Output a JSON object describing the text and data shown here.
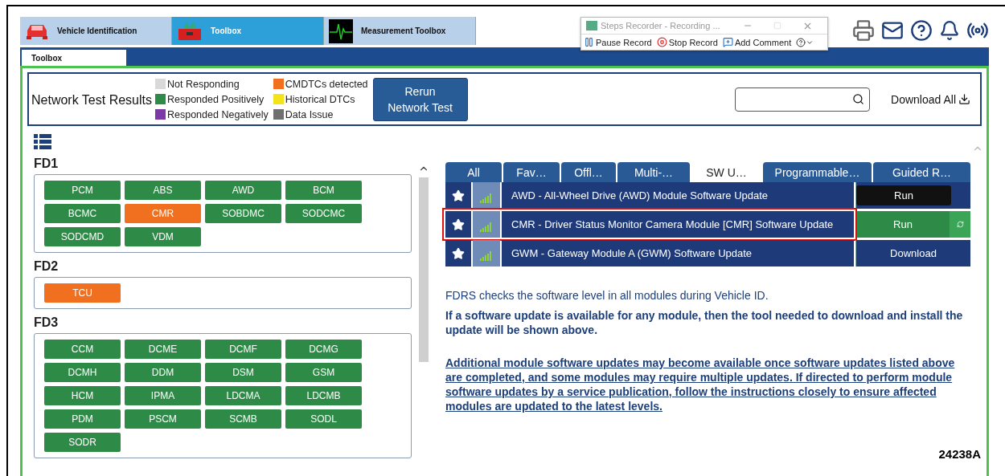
{
  "top_tabs": [
    {
      "label": "Vehicle Identification",
      "kind": "car",
      "selected": false
    },
    {
      "label": "Toolbox",
      "kind": "toolbox",
      "selected": true
    },
    {
      "label": "Measurement Toolbox",
      "kind": "scope",
      "selected": false
    }
  ],
  "recorder": {
    "title": "Steps Recorder - Recording ...",
    "buttons": [
      {
        "label": "Pause Record",
        "kind": "pause"
      },
      {
        "label": "Stop Record",
        "kind": "stop"
      },
      {
        "label": "Add Comment",
        "kind": "comment"
      }
    ]
  },
  "subtabs": [
    {
      "label": "Toolbox",
      "selected": true
    }
  ],
  "network_test": {
    "title": "Network Test Results",
    "legend": [
      {
        "label": "Not Responding",
        "color": "#d9d9d9"
      },
      {
        "label": "Responded Positively",
        "color": "#2e8b47"
      },
      {
        "label": "Responded Negatively",
        "color": "#7b3aa6"
      },
      {
        "label": "CMDTCs detected",
        "color": "#f07020"
      },
      {
        "label": "Historical DTCs",
        "color": "#f5e31a"
      },
      {
        "label": "Data Issue",
        "color": "#707070"
      }
    ],
    "button": "Rerun Network Test"
  },
  "download_all": "Download All",
  "groups": [
    {
      "name": "FD1",
      "modules": [
        {
          "label": "PCM",
          "color": "#2e8b47"
        },
        {
          "label": "ABS",
          "color": "#2e8b47"
        },
        {
          "label": "AWD",
          "color": "#2e8b47"
        },
        {
          "label": "BCM",
          "color": "#2e8b47"
        },
        {
          "label": "BCMC",
          "color": "#2e8b47"
        },
        {
          "label": "CMR",
          "color": "#f07020"
        },
        {
          "label": "SOBDMC",
          "color": "#2e8b47"
        },
        {
          "label": "SODCMC",
          "color": "#2e8b47"
        },
        {
          "label": "SODCMD",
          "color": "#2e8b47"
        },
        {
          "label": "VDM",
          "color": "#2e8b47"
        }
      ]
    },
    {
      "name": "FD2",
      "modules": [
        {
          "label": "TCU",
          "color": "#f07020"
        }
      ]
    },
    {
      "name": "FD3",
      "modules": [
        {
          "label": "CCM",
          "color": "#2e8b47"
        },
        {
          "label": "DCME",
          "color": "#2e8b47"
        },
        {
          "label": "DCMF",
          "color": "#2e8b47"
        },
        {
          "label": "DCMG",
          "color": "#2e8b47"
        },
        {
          "label": "DCMH",
          "color": "#2e8b47"
        },
        {
          "label": "DDM",
          "color": "#2e8b47"
        },
        {
          "label": "DSM",
          "color": "#2e8b47"
        },
        {
          "label": "GSM",
          "color": "#2e8b47"
        },
        {
          "label": "HCM",
          "color": "#2e8b47"
        },
        {
          "label": "IPMA",
          "color": "#2e8b47"
        },
        {
          "label": "LDCMA",
          "color": "#2e8b47"
        },
        {
          "label": "LDCMB",
          "color": "#2e8b47"
        },
        {
          "label": "PDM",
          "color": "#2e8b47"
        },
        {
          "label": "PSCM",
          "color": "#2e8b47"
        },
        {
          "label": "SCMB",
          "color": "#2e8b47"
        },
        {
          "label": "SODL",
          "color": "#2e8b47"
        },
        {
          "label": "SODR",
          "color": "#2e8b47"
        }
      ]
    }
  ],
  "tabs": [
    {
      "label": "All",
      "selected": false
    },
    {
      "label": "Fav…",
      "selected": false
    },
    {
      "label": "Offl…",
      "selected": false
    },
    {
      "label": "Multi-…",
      "selected": false
    },
    {
      "label": "SW U…",
      "selected": true
    },
    {
      "label": "Programmable…",
      "selected": false
    },
    {
      "label": "Guided R…",
      "selected": false
    }
  ],
  "updates": [
    {
      "title": "AWD - All-Wheel Drive (AWD) Module Software Update",
      "highlighted": false,
      "action": {
        "kind": "download",
        "tooltip": "Run"
      }
    },
    {
      "title": "CMR - Driver Status Monitor Camera Module [CMR] Software Update",
      "highlighted": true,
      "action": {
        "kind": "run",
        "label": "Run"
      }
    },
    {
      "title": "GWM - Gateway Module A (GWM) Software Update",
      "highlighted": false,
      "action": {
        "kind": "download",
        "label": "Download"
      }
    }
  ],
  "info": {
    "note": "FDRS checks the software level in all modules during Vehicle ID.",
    "bold": "If a software update is available for any module, then the tool needed to download and install the update will be shown above.",
    "link": "Additional module software updates may become available once software updates listed above are completed, and some modules may require multiple updates. If directed to perform module software updates by a service publication, follow the instructions closely to ensure affected modules are updated to the latest levels."
  },
  "figure_label": "24238A"
}
